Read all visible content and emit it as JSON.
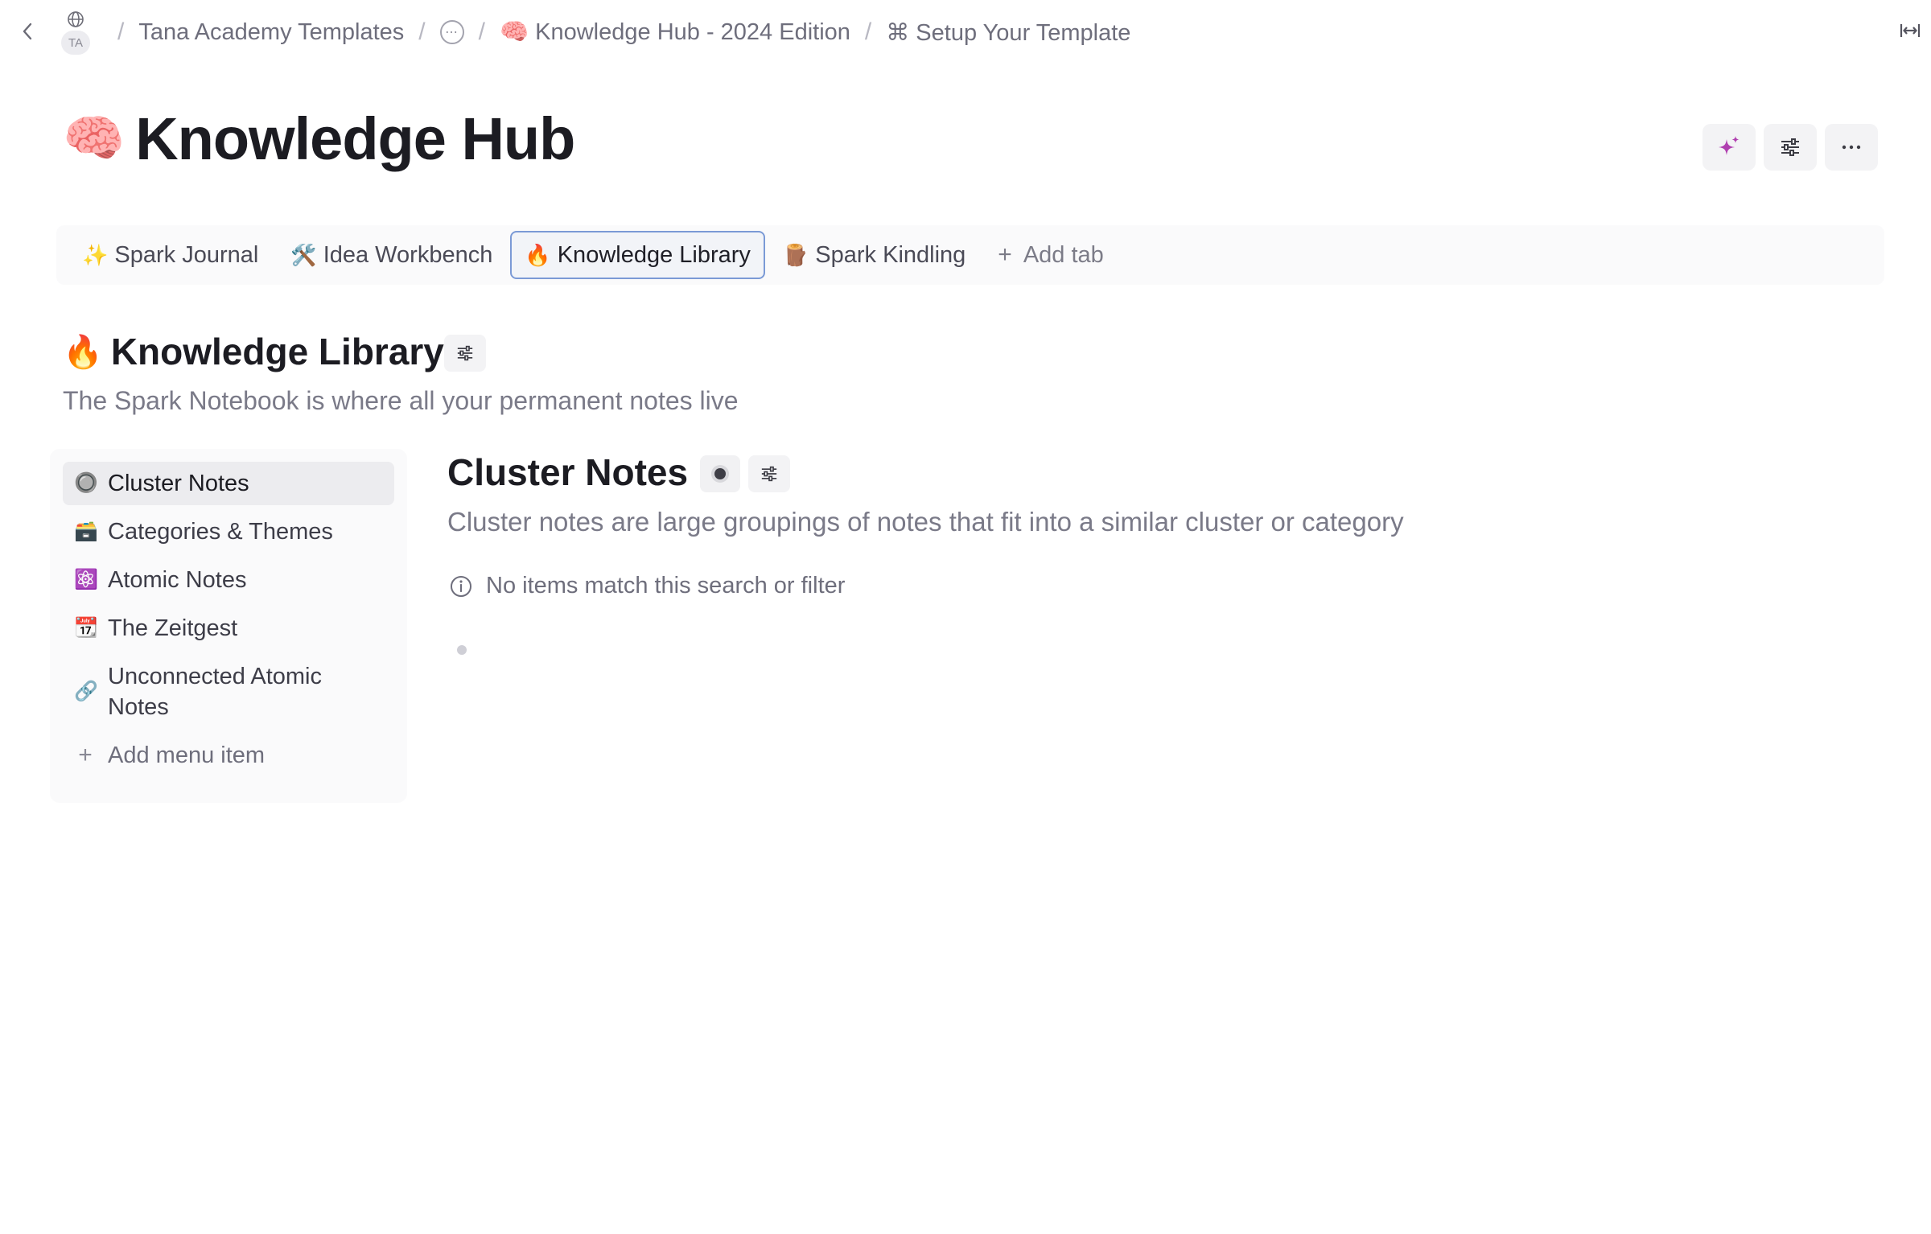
{
  "topbar": {
    "workspace_badge": "TA",
    "breadcrumbs": [
      {
        "label": "Tana Academy Templates"
      },
      {
        "label": "⋯"
      },
      {
        "label": "🧠 Knowledge Hub - 2024 Edition"
      },
      {
        "label": "⌘ Setup Your Template"
      }
    ]
  },
  "header": {
    "emoji": "🧠",
    "title": "Knowledge Hub",
    "actions": [
      {
        "icon": "sparkle-icon"
      },
      {
        "icon": "sliders-icon"
      },
      {
        "icon": "more-icon"
      }
    ]
  },
  "tabs": [
    {
      "emoji": "✨",
      "label": "Spark Journal"
    },
    {
      "emoji": "🛠️",
      "label": "Idea Workbench"
    },
    {
      "emoji": "🔥",
      "label": "Knowledge Library",
      "active": true
    },
    {
      "emoji": "🪵",
      "label": "Spark Kindling"
    }
  ],
  "add_tab_label": "Add tab",
  "section": {
    "emoji": "🔥",
    "title": "Knowledge Library",
    "description": "The Spark Notebook is where all your permanent notes live"
  },
  "menu": {
    "items": [
      {
        "emoji": "🔘",
        "label": "Cluster Notes",
        "active": true
      },
      {
        "emoji": "🗃️",
        "label": "Categories & Themes"
      },
      {
        "emoji": "⚛️",
        "label": "Atomic Notes"
      },
      {
        "emoji": "📆",
        "label": "The Zeitgest"
      },
      {
        "emoji": "🔗",
        "label": "Unconnected Atomic Notes"
      }
    ],
    "add_label": "Add menu item"
  },
  "main": {
    "title": "Cluster Notes",
    "description": "Cluster notes are large groupings of notes that fit into a similar cluster or category",
    "empty_message": "No items match this search or filter"
  },
  "colors": {
    "accent_border": "#7b9ad6",
    "sparkle": "#b03fb0",
    "text_muted": "#7a7a88"
  }
}
